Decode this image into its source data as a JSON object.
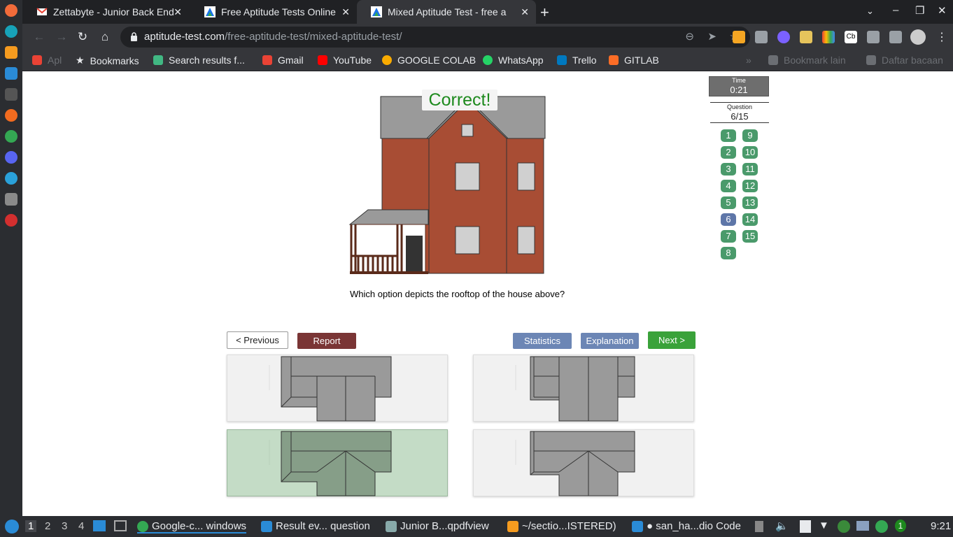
{
  "browser": {
    "tabs": [
      {
        "title": "Zettabyte - Junior Back End",
        "favicon": "gmail-icon"
      },
      {
        "title": "Free Aptitude Tests Online",
        "favicon": "aptitude-test-icon"
      },
      {
        "title": "Mixed Aptitude Test - free a",
        "favicon": "aptitude-test-icon"
      }
    ],
    "new_tab": "+",
    "url_host": "aptitude-test.com",
    "url_path": "/free-aptitude-test/mixed-aptitude-test/",
    "bookmarks": [
      {
        "label": "Apl",
        "icon": "apps-grid-icon",
        "dim": true
      },
      {
        "label": "Bookmarks",
        "icon": "star-icon"
      },
      {
        "label": "Search results f...",
        "icon": "vuejs-icon"
      },
      {
        "label": "Gmail",
        "icon": "gmail-icon"
      },
      {
        "label": "YouTube",
        "icon": "youtube-icon"
      },
      {
        "label": "GOOGLE COLAB",
        "icon": "colab-icon"
      },
      {
        "label": "WhatsApp",
        "icon": "whatsapp-icon"
      },
      {
        "label": "Trello",
        "icon": "trello-icon"
      },
      {
        "label": "GITLAB",
        "icon": "gitlab-icon"
      }
    ],
    "bookmarks_overflow": "»",
    "other_bookmarks": "Bookmark lain",
    "reading_list": "Daftar bacaan"
  },
  "quiz": {
    "feedback": "Correct!",
    "question": "Which option depicts the rooftop of the house above?",
    "time_label": "Time",
    "time_value": "0:21",
    "question_label": "Question",
    "question_value": "6/15",
    "current_question": 6,
    "question_numbers": [
      "1",
      "2",
      "3",
      "4",
      "5",
      "6",
      "7",
      "8",
      "9",
      "10",
      "11",
      "12",
      "13",
      "14",
      "15"
    ],
    "buttons": {
      "previous": "<  Previous",
      "report": "Report",
      "statistics": "Statistics",
      "explanation": "Explanation",
      "next": "Next  >"
    },
    "selected_option": 3
  },
  "taskbar": {
    "workspaces": [
      "1",
      "2",
      "3",
      "4"
    ],
    "active_workspace": "1",
    "items": [
      {
        "label": "Google-c... windows",
        "icon": "chrome-icon"
      },
      {
        "label": "Result ev... question",
        "icon": "folder-icon"
      },
      {
        "label": "Junior B...qpdfview",
        "icon": "pdf-viewer-icon"
      },
      {
        "label": "~/sectio...ISTERED)",
        "icon": "sublime-text-icon"
      },
      {
        "label": "● san_ha...dio Code",
        "icon": "vscode-icon"
      }
    ],
    "update_badge": "1",
    "clock": "9:21"
  },
  "colors": {
    "correct": "#1e8a1e",
    "answered": "#4a9a6b",
    "current": "#5e76a8",
    "brick": "#a84d34",
    "roof": "#9a9a9a"
  }
}
